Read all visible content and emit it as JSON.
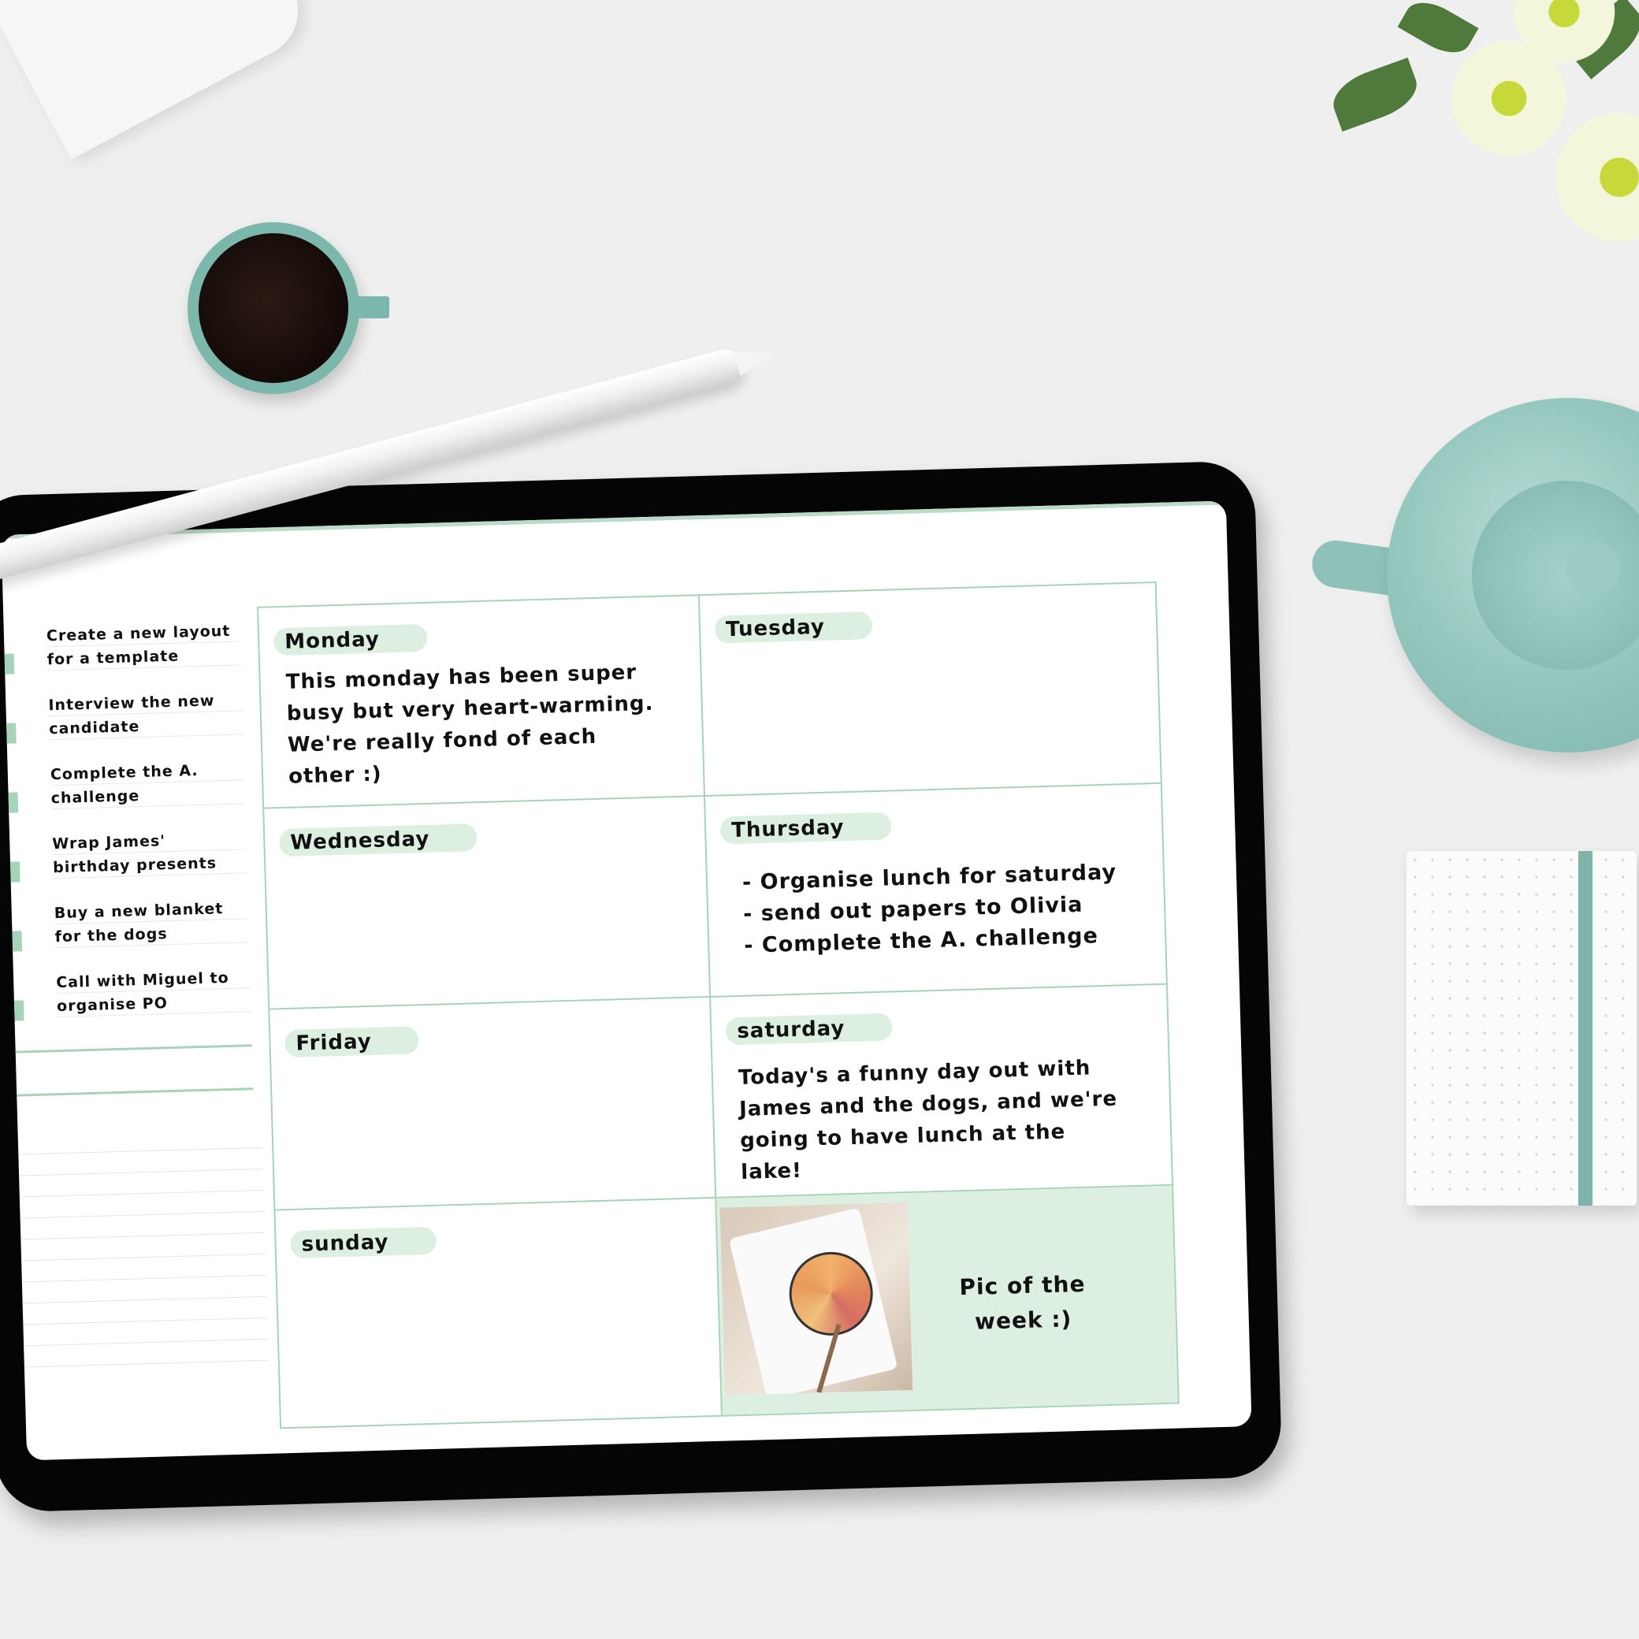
{
  "planner": {
    "tasks": [
      {
        "text": "Create a new layout for a template"
      },
      {
        "text": "Interview the new candidate"
      },
      {
        "text": "Complete the A. challenge"
      },
      {
        "text": "Wrap James' birthday presents"
      },
      {
        "text": "Buy a new blanket for the dogs"
      },
      {
        "text": "Call with Miguel to organise PO"
      }
    ],
    "days": {
      "monday": {
        "label": "Monday",
        "body": "This monday has been super busy but very heart-warming. We're really fond of each other :)"
      },
      "tuesday": {
        "label": "Tuesday",
        "body": ""
      },
      "wednesday": {
        "label": "Wednesday",
        "body": ""
      },
      "thursday": {
        "label": "Thursday",
        "items": [
          "- Organise lunch for saturday",
          "- send out papers to Olivia",
          "- Complete the A. challenge"
        ]
      },
      "friday": {
        "label": "Friday",
        "body": ""
      },
      "saturday": {
        "label": "saturday",
        "body": "Today's a funny day out with James and the dogs, and we're going to have lunch at the lake!"
      },
      "sunday": {
        "label": "sunday",
        "body": ""
      }
    },
    "pic_of_week": {
      "label": "Pic of the week :)"
    }
  },
  "colors": {
    "accent_green": "#a7d3b8",
    "pill_green": "#dcefe1",
    "teal_props": "#7fb4aa"
  }
}
